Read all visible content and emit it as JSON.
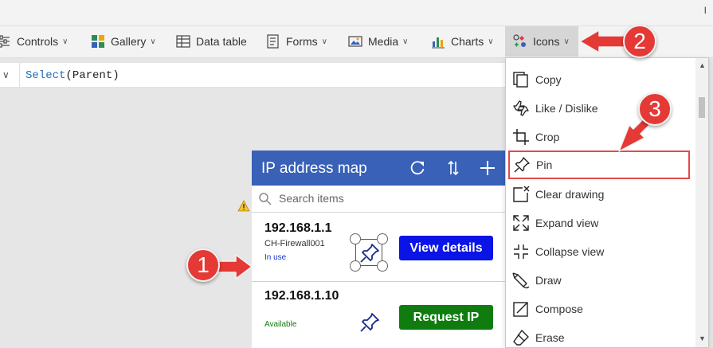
{
  "titlebar": {
    "right_mark": "I"
  },
  "ribbon": {
    "items": [
      {
        "label": "Controls",
        "icon": "controls-icon",
        "has_chevron": true
      },
      {
        "label": "Gallery",
        "icon": "gallery-icon",
        "has_chevron": true
      },
      {
        "label": "Data table",
        "icon": "data-table-icon",
        "has_chevron": false
      },
      {
        "label": "Forms",
        "icon": "forms-icon",
        "has_chevron": true
      },
      {
        "label": "Media",
        "icon": "media-icon",
        "has_chevron": true
      },
      {
        "label": "Charts",
        "icon": "charts-icon",
        "has_chevron": true
      },
      {
        "label": "Icons",
        "icon": "icons-icon",
        "has_chevron": true,
        "active": true
      }
    ]
  },
  "formula": {
    "fn": "Select",
    "args": "(Parent)"
  },
  "app": {
    "title": "IP address map",
    "search_placeholder": "Search items",
    "items": [
      {
        "ip": "192.168.1.1",
        "host": "CH-Firewall001",
        "status": "In use",
        "status_color": "#1a35cc",
        "button": "View details",
        "button_color": "#0a14e6"
      },
      {
        "ip": "192.168.1.10",
        "host": "",
        "status": "Available",
        "status_color": "#107c10",
        "button": "Request IP",
        "button_color": "#107c10"
      }
    ]
  },
  "icons_menu": {
    "items": [
      {
        "label": "Copy",
        "icon": "copy-icon"
      },
      {
        "label": "Like / Dislike",
        "icon": "like-dislike-icon"
      },
      {
        "label": "Crop",
        "icon": "crop-icon"
      },
      {
        "label": "Pin",
        "icon": "pin-icon",
        "highlighted": true
      },
      {
        "label": "Clear drawing",
        "icon": "clear-drawing-icon"
      },
      {
        "label": "Expand view",
        "icon": "expand-view-icon"
      },
      {
        "label": "Collapse view",
        "icon": "collapse-view-icon"
      },
      {
        "label": "Draw",
        "icon": "draw-icon"
      },
      {
        "label": "Compose",
        "icon": "compose-icon"
      },
      {
        "label": "Erase",
        "icon": "erase-icon"
      }
    ]
  },
  "callouts": [
    {
      "number": "1"
    },
    {
      "number": "2"
    },
    {
      "number": "3"
    }
  ],
  "colors": {
    "accent": "#3861b7",
    "callout": "#e53935",
    "highlight": "#e24a4a"
  }
}
